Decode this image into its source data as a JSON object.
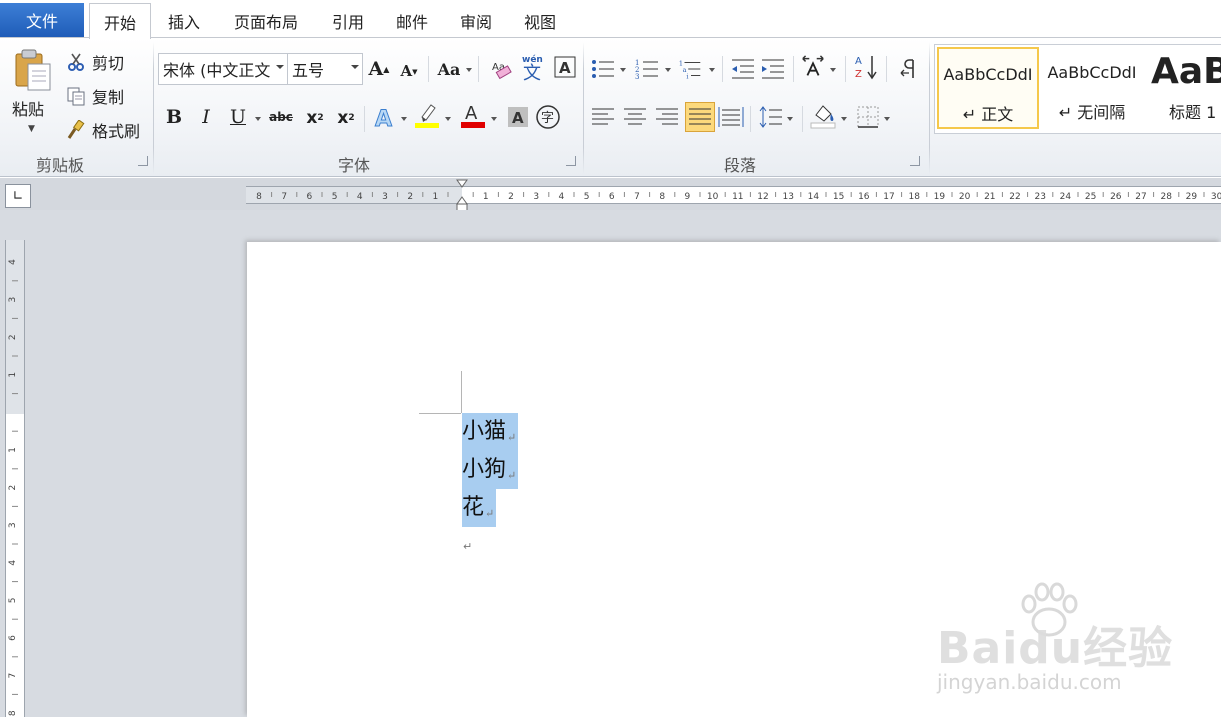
{
  "menu": {
    "file": "文件",
    "tabs": [
      "开始",
      "插入",
      "页面布局",
      "引用",
      "邮件",
      "审阅",
      "视图"
    ]
  },
  "clipboard": {
    "paste": "粘贴",
    "cut": "剪切",
    "copy": "复制",
    "format_painter": "格式刷",
    "group_label": "剪贴板"
  },
  "font": {
    "font_name": "宋体 (中文正文",
    "font_size": "五号",
    "group_label": "字体",
    "highlight_color": "#ffff00",
    "font_color": "#e00000"
  },
  "paragraph": {
    "group_label": "段落"
  },
  "styles": {
    "items": [
      {
        "sample": "AaBbCcDdI",
        "name": "↵ 正文"
      },
      {
        "sample": "AaBbCcDdI",
        "name": "↵ 无间隔"
      },
      {
        "sample": "AaB",
        "name": "标题 1"
      }
    ]
  },
  "ruler": {
    "horizontal_ticks": [
      "8",
      "7",
      "6",
      "5",
      "4",
      "3",
      "2",
      "1",
      "",
      "1",
      "2",
      "3",
      "4",
      "5",
      "6",
      "7",
      "8",
      "9",
      "10",
      "11",
      "12",
      "13",
      "14",
      "15",
      "16",
      "17",
      "18",
      "19",
      "20",
      "21",
      "22",
      "23",
      "24",
      "25",
      "26",
      "27",
      "28",
      "29",
      "30"
    ],
    "vertical_ticks": [
      "4",
      "3",
      "2",
      "1",
      "",
      "1",
      "2",
      "3",
      "4",
      "5",
      "6",
      "7",
      "8"
    ]
  },
  "document": {
    "lines": [
      "小猫",
      "小狗",
      "花"
    ],
    "selection_color": "#a8cdf0",
    "paragraph_mark": "↵"
  },
  "watermark": {
    "brand": "Baidu经验",
    "url": "jingyan.baidu.com"
  }
}
